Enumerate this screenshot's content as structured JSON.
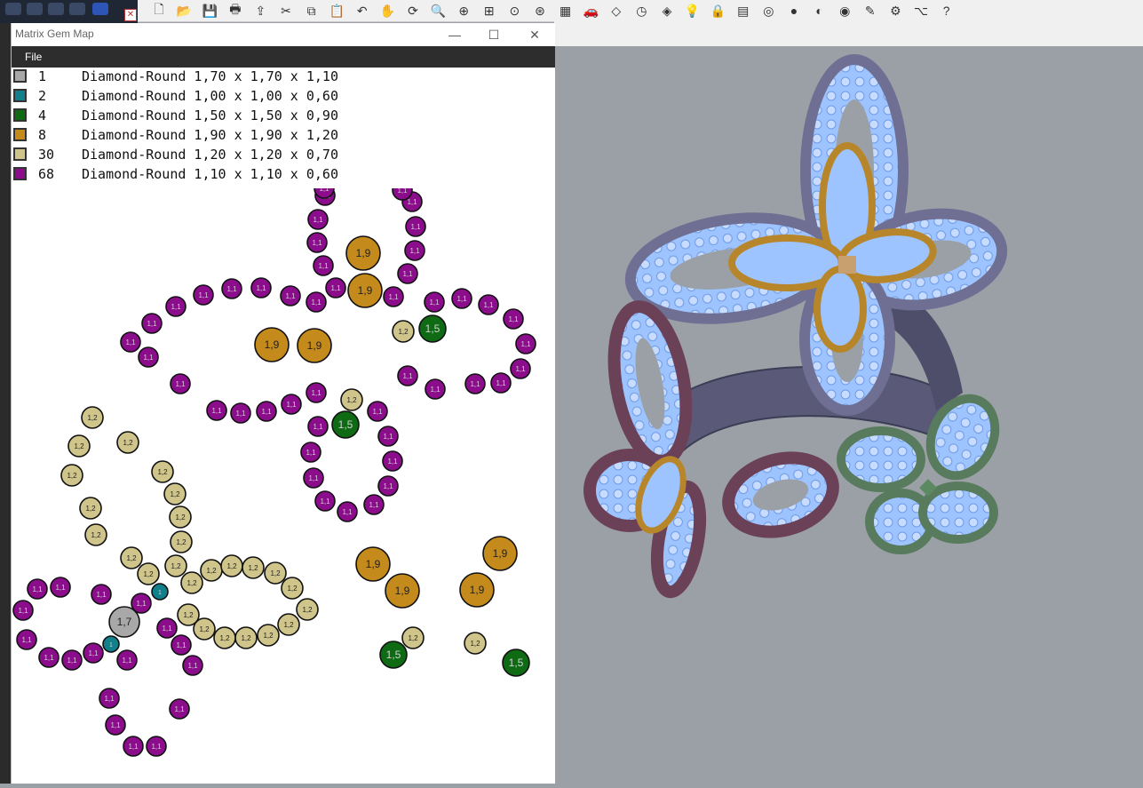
{
  "window": {
    "title": "Matrix Gem Map"
  },
  "menu": {
    "file": "File"
  },
  "legend": [
    {
      "count": "1",
      "desc": "Diamond-Round 1,70 x 1,70 x 1,10",
      "color": "#a8a8a8"
    },
    {
      "count": "2",
      "desc": "Diamond-Round 1,00 x 1,00 x 0,60",
      "color": "#12808a"
    },
    {
      "count": "4",
      "desc": "Diamond-Round 1,50 x 1,50 x 0,90",
      "color": "#0e6b14"
    },
    {
      "count": "8",
      "desc": "Diamond-Round 1,90 x 1,90 x 1,20",
      "color": "#c48a1c"
    },
    {
      "count": "30",
      "desc": "Diamond-Round 1,20 x 1,20 x 0,70",
      "color": "#cfc48a"
    },
    {
      "count": "68",
      "desc": "Diamond-Round 1,10 x 1,10 x 0,60",
      "color": "#8b0d8c"
    }
  ],
  "gem_labels": {
    "s17": "1,7",
    "s10": "1",
    "s15": "1,5",
    "s19": "1,9",
    "s12": "1,2",
    "s11": "1,1"
  },
  "colors": {
    "s17": "#a8a8a8",
    "s10": "#12808a",
    "s15": "#0e6b14",
    "s19": "#c48a1c",
    "s12": "#cfc48a",
    "s11": "#8b0d8c"
  },
  "toolbar_icons": [
    "new-file-icon",
    "open-folder-icon",
    "save-icon",
    "print-icon",
    "export-icon",
    "cut-icon",
    "copy-icon",
    "paste-icon",
    "undo-icon",
    "pan-hand-icon",
    "rotate-view-icon",
    "zoom-icon",
    "zoom-window-icon",
    "zoom-extents-icon",
    "zoom-selected-icon",
    "zoom-dynamic-icon",
    "grid-4view-icon",
    "car-icon",
    "wireframe-icon",
    "clock-icon",
    "shapes-icon",
    "bulb-icon",
    "lock-icon",
    "layers-icon",
    "color-wheel-icon",
    "sphere-shaded-icon",
    "sphere-rendered-icon",
    "sphere-blue-icon",
    "pencil-icon",
    "gear-icon",
    "network-icon",
    "help-icon"
  ]
}
